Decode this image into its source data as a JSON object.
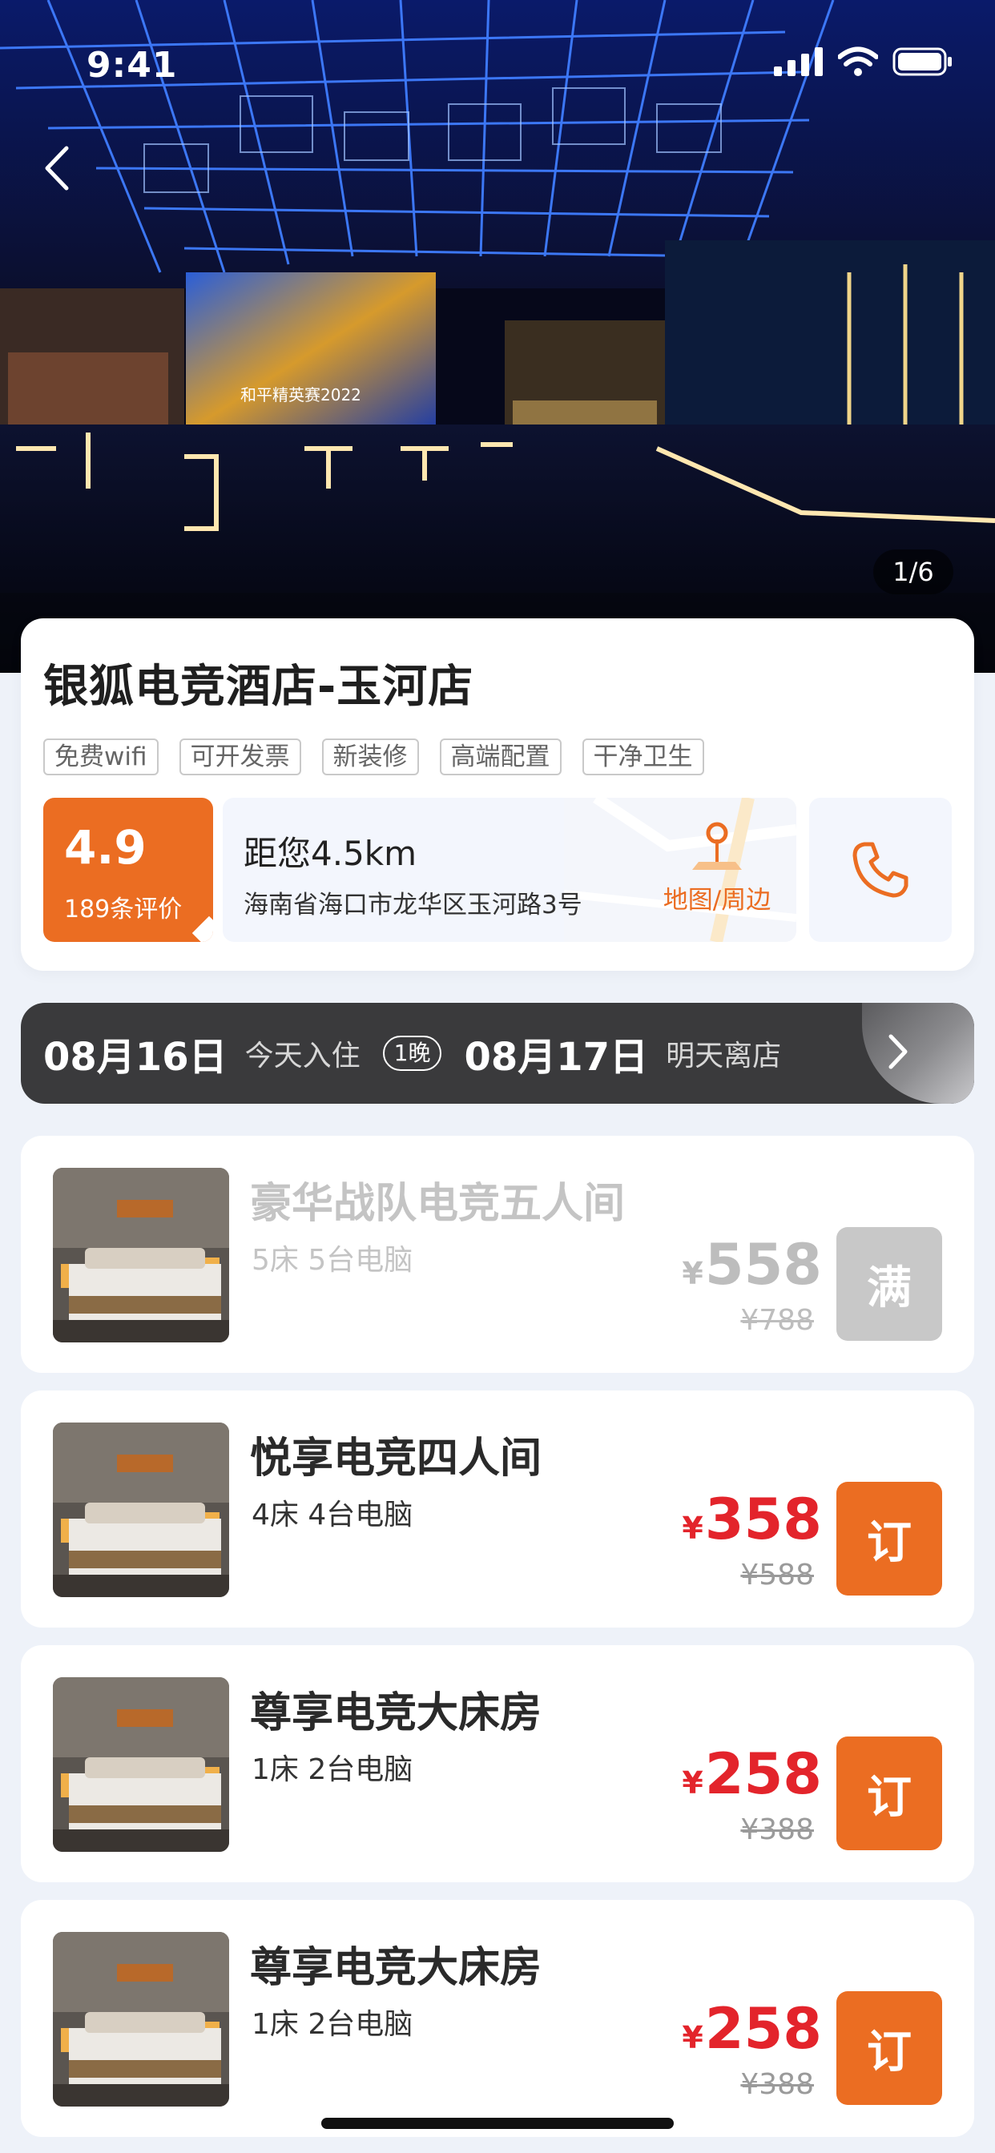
{
  "status_bar": {
    "time": "9:41"
  },
  "gallery": {
    "counter": "1/6",
    "screen_text": "和平精英赛2022"
  },
  "hotel": {
    "name": "银狐电竞酒店-玉河店",
    "tags": [
      "免费wifi",
      "可开发票",
      "新装修",
      "高端配置",
      "干净卫生"
    ],
    "rating": {
      "score": "4.9",
      "count": "189条评价"
    },
    "location": {
      "distance": "距您4.5km",
      "address": "海南省海口市龙华区玉河路3号",
      "map_label": "地图/周边"
    }
  },
  "dates": {
    "checkin": "08月16日",
    "checkin_label": "今天入住",
    "nights": "1晚",
    "checkout": "08月17日",
    "checkout_label": "明天离店"
  },
  "rooms": [
    {
      "name": "豪华战队电竞五人间",
      "spec": "5床  5台电脑",
      "currency": "¥",
      "price": "558",
      "old_price": "¥788",
      "action": "满",
      "available": false
    },
    {
      "name": "悦享电竞四人间",
      "spec": "4床  4台电脑",
      "currency": "¥",
      "price": "358",
      "old_price": "¥588",
      "action": "订",
      "available": true
    },
    {
      "name": "尊享电竞大床房",
      "spec": "1床  2台电脑",
      "currency": "¥",
      "price": "258",
      "old_price": "¥388",
      "action": "订",
      "available": true
    },
    {
      "name": "尊享电竞大床房",
      "spec": "1床  2台电脑",
      "currency": "¥",
      "price": "258",
      "old_price": "¥388",
      "action": "订",
      "available": true
    }
  ],
  "colors": {
    "accent": "#eb6d22",
    "price": "#e3242b",
    "date_bar": "#3a3a3c",
    "page_bg": "#eef2f9"
  }
}
